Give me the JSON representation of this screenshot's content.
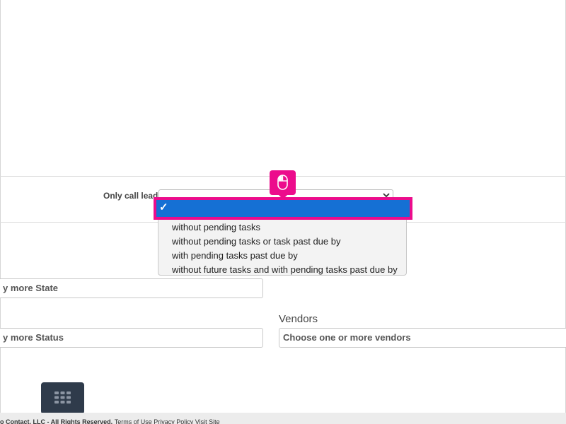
{
  "lead_filter": {
    "label": "Only call leads",
    "selected_value": "",
    "options": [
      "",
      "without pending tasks",
      "without pending tasks or task past due by",
      "with pending tasks past due by",
      "without future tasks and with pending tasks past due by"
    ],
    "check_mark": "✓"
  },
  "state_field": {
    "placeholder": "y more State"
  },
  "status_field": {
    "placeholder": "y more Status"
  },
  "vendors": {
    "label": "Vendors",
    "placeholder": "Choose one or more vendors"
  },
  "footer": {
    "copyright": "o Contact, LLC - All Rights Reserved.",
    "links": [
      "Terms of Use",
      "Privacy Policy",
      "Visit Site"
    ]
  },
  "icons": {
    "cursor": "mouse-click-icon",
    "grid": "grid-menu-icon",
    "chevron": "chevron-down-icon"
  },
  "colors": {
    "highlight": "#ec0c8c",
    "selection": "#1570d4",
    "grid_button": "#2f3b4b"
  }
}
